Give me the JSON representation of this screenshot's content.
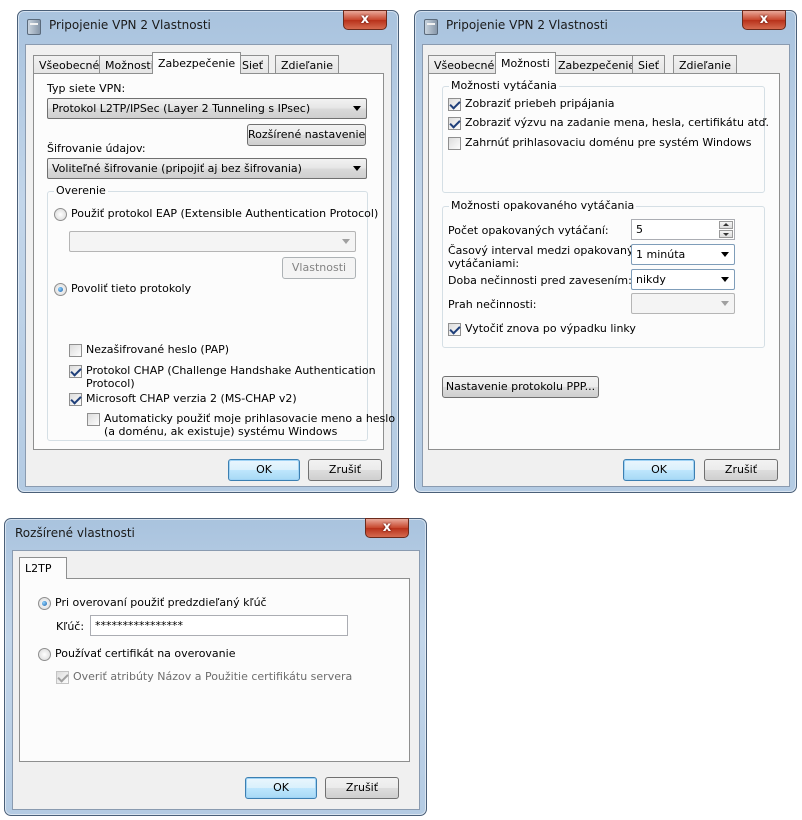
{
  "win1": {
    "title": "Pripojenie VPN 2 Vlastnosti",
    "close": "x",
    "tabs": [
      "Všeobecné",
      "Možnosti",
      "Zabezpečenie",
      "Sieť",
      "Zdieľanie"
    ],
    "vpn_type_label": "Typ siete VPN:",
    "vpn_type_value": "Protokol L2TP/IPSec (Layer 2 Tunneling s IPsec)",
    "advanced_button": "Rozšírené nastavenie",
    "encryption_label": "Šifrovanie údajov:",
    "encryption_value": "Voliteľné šifrovanie (pripojiť aj bez šifrovania)",
    "auth_group": "Overenie",
    "eap_radio": "Použiť protokol EAP (Extensible Authentication Protocol)",
    "eap_combo": "",
    "eap_properties": "Vlastnosti",
    "allow_radio": "Povoliť tieto protokoly",
    "pap": "Nezašifrované heslo (PAP)",
    "chap_line1": "Protokol CHAP (Challenge Handshake Authentication",
    "chap_line2": "Protocol)",
    "mschap": "Microsoft CHAP verzia 2 (MS-CHAP v2)",
    "auto_line1": "Automaticky použiť moje prihlasovacie meno a heslo",
    "auto_line2": "(a doménu, ak existuje) systému Windows",
    "ok": "OK",
    "cancel": "Zrušiť"
  },
  "win2": {
    "title": "Pripojenie VPN 2 Vlastnosti",
    "close": "x",
    "tabs": [
      "Všeobecné",
      "Možnosti",
      "Zabezpečenie",
      "Sieť",
      "Zdieľanie"
    ],
    "dial_group": "Možnosti vytáčania",
    "show_progress": "Zobraziť priebeh pripájania",
    "prompt_credentials": "Zobraziť výzvu na zadanie mena, hesla, certifikátu atď.",
    "include_domain": "Zahrnúť prihlasovaciu doménu pre systém Windows",
    "redial_group": "Možnosti opakovaného vytáčania",
    "redial_count_label": "Počet opakovaných vytáčaní:",
    "redial_count_value": "5",
    "interval_label_line1": "Časový interval medzi opakovanými",
    "interval_label_line2": "vytáčaniami:",
    "interval_value": "1 minúta",
    "idle_label": "Doba nečinnosti pred zavesením:",
    "idle_value": "nikdy",
    "threshold_label": "Prah nečinnosti:",
    "threshold_value": "",
    "redial_on_drop": "Vytočiť znova po výpadku linky",
    "ppp_button": "Nastavenie protokolu PPP...",
    "ok": "OK",
    "cancel": "Zrušiť"
  },
  "win3": {
    "title": "Rozšírené vlastnosti",
    "close": "x",
    "tab": "L2TP",
    "psk_radio": "Pri overovaní použiť predzdieľaný kľúč",
    "key_label": "Kľúč:",
    "key_value": "****************",
    "cert_radio": "Používať certifikát na overovanie",
    "verify_cert": "Overiť atribúty Názov a Použitie certifikátu servera",
    "ok": "OK",
    "cancel": "Zrušiť"
  }
}
